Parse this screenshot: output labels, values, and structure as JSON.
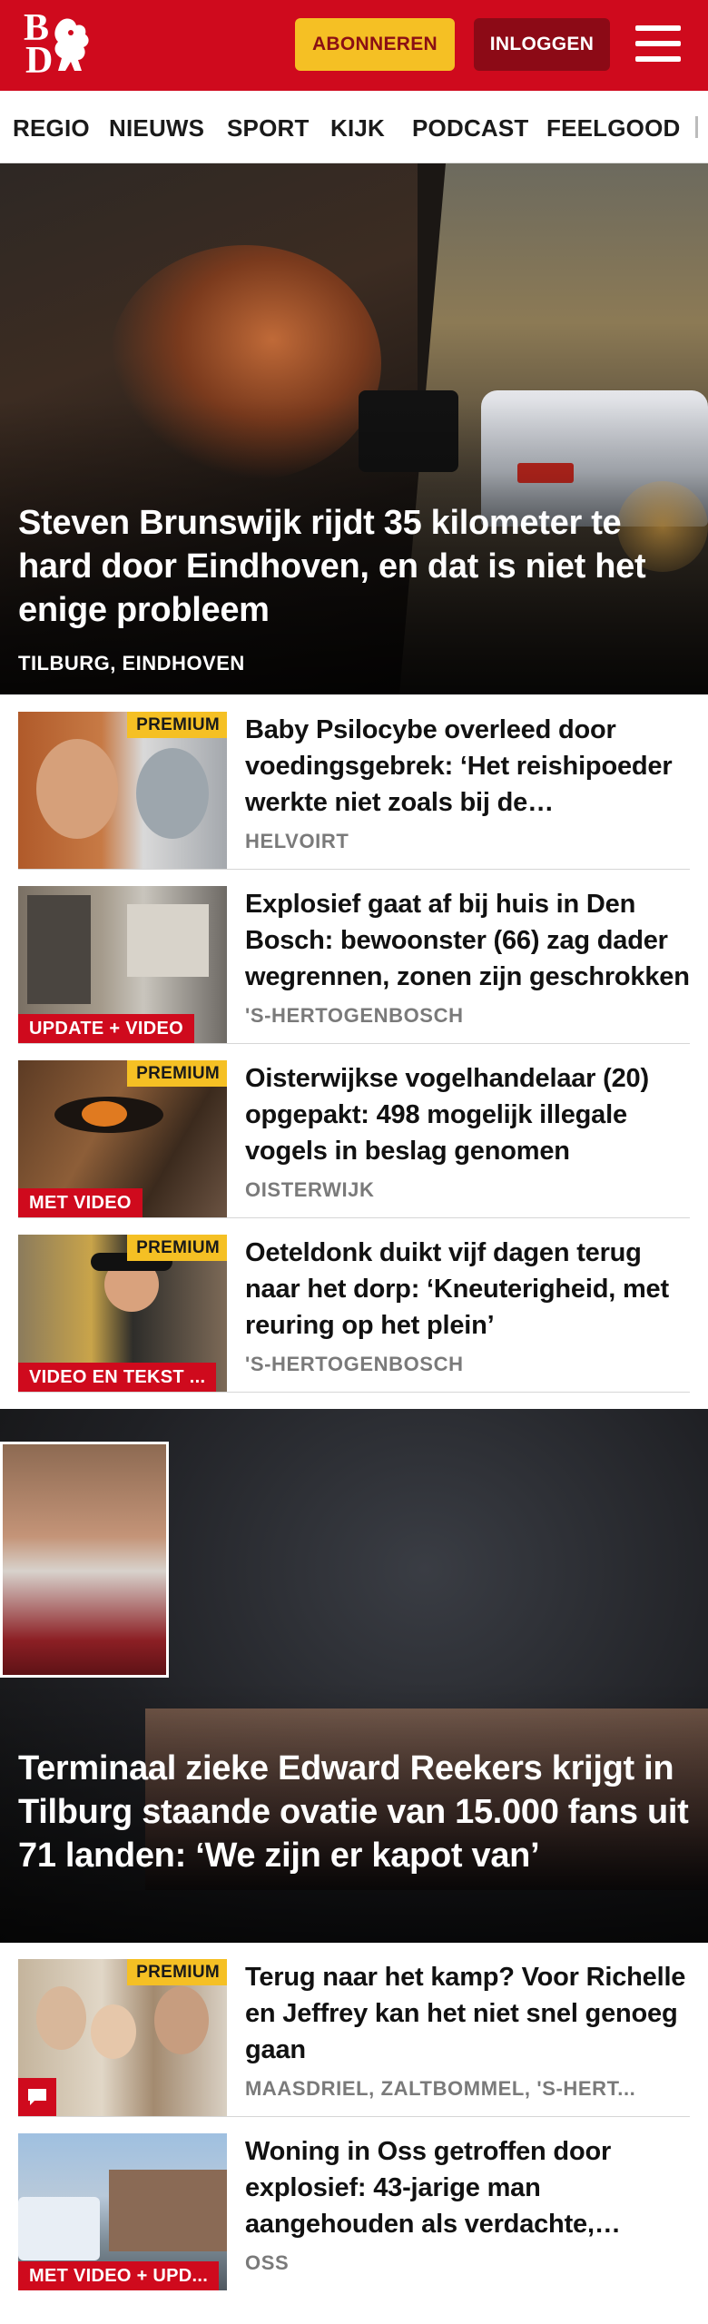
{
  "header": {
    "logo_text_top": "B",
    "logo_text_bottom": "D",
    "subscribe_label": "ABONNEREN",
    "login_label": "INLOGGEN",
    "menu_icon": "hamburger-menu-icon",
    "brand_color": "#cf0a1d"
  },
  "nav": {
    "items": [
      "REGIO",
      "NIEUWS",
      "SPORT",
      "KIJK",
      "PODCAST",
      "FEELGOOD"
    ]
  },
  "hero1": {
    "title": "Steven Brunswijk rijdt 35 kilometer te hard door Eindhoven, en dat is niet het enige probleem",
    "location": "TILBURG, EINDHOVEN"
  },
  "articles": [
    {
      "title": "Baby Psilocybe overleed door voedingsgebrek: ‘Het reishipoeder werkte niet zoals bij de volwassenen’",
      "location": "HELVOIRT",
      "premium": "PREMIUM",
      "tag": ""
    },
    {
      "title": "Explosief gaat af bij huis in Den Bosch: bewoonster (66) zag dader wegrennen, zonen zijn geschrokken",
      "location": "'S-HERTOGENBOSCH",
      "premium": "",
      "tag": "UPDATE + VIDEO"
    },
    {
      "title": "Oisterwijkse vogelhandelaar (20) opgepakt: 498 mogelijk illegale vogels in beslag genomen",
      "location": "OISTERWIJK",
      "premium": "PREMIUM",
      "tag": "MET VIDEO"
    },
    {
      "title": "Oeteldonk duikt vijf dagen terug naar het dorp: ‘Kneuterigheid, met reuring op het plein’",
      "location": "'S-HERTOGENBOSCH",
      "premium": "PREMIUM",
      "tag": "VIDEO EN TEKST ..."
    }
  ],
  "hero2": {
    "title": "Terminaal zieke Edward Reekers krijgt in Tilburg staande ovatie van 15.000 fans uit 71 landen: ‘We zijn er kapot van’"
  },
  "articles2": [
    {
      "title": "Terug naar het kamp? Voor Richelle en Jeffrey kan het niet snel genoeg gaan",
      "location": "MAASDRIEL, ZALTBOMMEL, 'S-HERT...",
      "premium": "PREMIUM",
      "tag": ""
    },
    {
      "title": "Woning in Oss getroffen door explosief: 43-jarige man aangehouden als verdachte, schade groot",
      "location": "OSS",
      "premium": "",
      "tag": "MET VIDEO + UPD..."
    }
  ]
}
